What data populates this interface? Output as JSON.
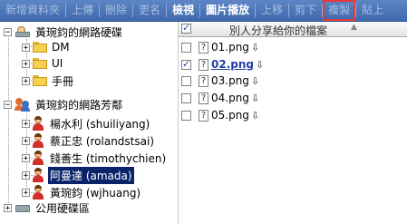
{
  "toolbar": {
    "buttons": [
      {
        "label": "新增資料夾",
        "state": "disabled"
      },
      {
        "label": "上傳",
        "state": "disabled"
      },
      {
        "label": "刪除",
        "state": "disabled"
      },
      {
        "label": "更名",
        "state": "disabled"
      },
      {
        "label": "檢視",
        "state": "active"
      },
      {
        "label": "圖片播放",
        "state": "active"
      },
      {
        "label": "上移",
        "state": "disabled"
      },
      {
        "label": "剪下",
        "state": "disabled"
      },
      {
        "label": "複製",
        "state": "highlighted"
      },
      {
        "label": "貼上",
        "state": "disabled"
      }
    ]
  },
  "tree": {
    "my_drive": {
      "label": "黃琬鈞的網路硬碟",
      "expander": "−",
      "folders": [
        "DM",
        "UI",
        "手冊"
      ]
    },
    "my_neighbors": {
      "label": "黃琬鈞的網路芳鄰",
      "expander": "−",
      "people": [
        "楊水利 (shuiliyang)",
        "蔡正忠 (rolandstsai)",
        "錢善生 (timothychien)",
        "阿曼達 (amada)",
        "黃琬鈞 (wjhuang)"
      ],
      "selected_person": "阿曼達 (amada)"
    },
    "public_drive": {
      "label": "公用硬碟區",
      "expander": "+"
    }
  },
  "file_list": {
    "header": {
      "title": "別人分享給你的檔案",
      "sort_indicator": "▲"
    },
    "files": [
      {
        "name": "01.png",
        "checked": false
      },
      {
        "name": "02.png",
        "checked": true
      },
      {
        "name": "03.png",
        "checked": false
      },
      {
        "name": "04.png",
        "checked": false
      },
      {
        "name": "05.png",
        "checked": false
      }
    ],
    "file_icon_glyph": "?",
    "download_glyph": "⇩"
  },
  "colors": {
    "toolbar_bg": "#4f79bd",
    "selection_bg": "#0a246a",
    "highlight_border": "#e53935",
    "link": "#2441a5"
  }
}
